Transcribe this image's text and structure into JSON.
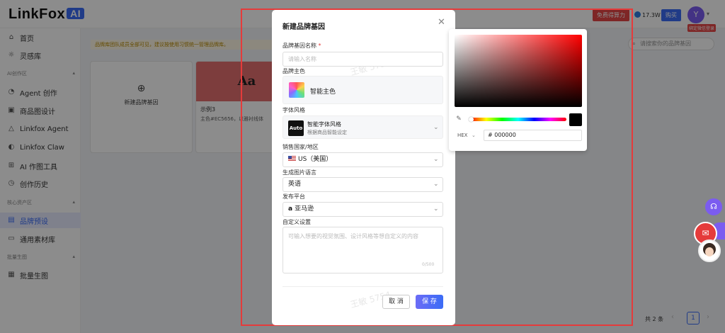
{
  "app": {
    "logo": "LinkFox",
    "logo_badge": "AI"
  },
  "header": {
    "free_compute_label": "免费得算力",
    "credits": "17.3W",
    "buy_label": "购买",
    "avatar_letter": "Y",
    "bind_wechat_badge": "绑定微信登录"
  },
  "sidebar": {
    "home": "首页",
    "inspiration": "灵感库",
    "section_ai": "AI创作区",
    "agent_create": "Agent 创作",
    "product_design": "商品图设计",
    "linkfox_agent": "Linkfox Agent",
    "linkfox_claw": "Linkfox Claw",
    "ai_tools": "AI 作图工具",
    "history": "创作历史",
    "section_core": "核心资产区",
    "brand_preset": "品牌预设",
    "materials": "通用素材库",
    "section_batch": "批量生图",
    "batch_gen": "批量生图"
  },
  "main": {
    "notice": "品牌库团队成员全部可见，建议按使用习惯统一管理品牌库。",
    "search_placeholder": "请搜索你的品牌基因",
    "new_card_label": "新建品牌基因",
    "example_preview": "Aa",
    "example_name": "示例3",
    "example_desc": "主色#EC5656，以雅衬线体",
    "pager_total": "共 2 条",
    "pager_current": "1"
  },
  "modal": {
    "title": "新建品牌基因",
    "name_label": "品牌基因名称",
    "required_mark": "*",
    "name_placeholder": "请输入名称",
    "main_color_label": "品牌主色",
    "main_color_value": "智能主色",
    "font_style_label": "字体风格",
    "font_icon_text": "Auto",
    "font_style_title": "智能字体风格",
    "font_style_desc": "根据商品智能设定",
    "country_label": "销售国家/地区",
    "country_value": "US（美国）",
    "language_label": "生成图片语言",
    "language_value": "英语",
    "platform_label": "发布平台",
    "platform_icon_text": "a",
    "platform_value": "亚马逊",
    "custom_label": "自定义设置",
    "custom_placeholder": "可输入想要的视觉氛围、设计风格等想自定义的内容",
    "char_count": "0/500",
    "cancel_label": "取 消",
    "save_label": "保 存",
    "watermark": "王敏 5754"
  },
  "color_picker": {
    "format_label": "HEX",
    "hex_value": "# 000000",
    "current_color": "#000000",
    "hue_color": "#ff0000"
  }
}
